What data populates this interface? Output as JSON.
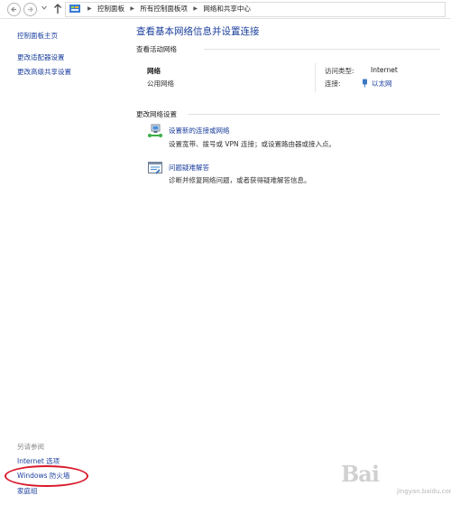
{
  "address_bar": {
    "breadcrumbs": [
      "控制面板",
      "所有控制面板项",
      "网络和共享中心"
    ]
  },
  "left_nav": {
    "home": "控制面板主页",
    "change_adapter": "更改适配器设置",
    "change_sharing": "更改高级共享设置",
    "see_also": "另请参阅",
    "internet_options": "Internet 选项",
    "firewall": "Windows 防火墙",
    "homegroup": "家庭组"
  },
  "main": {
    "title": "查看基本网络信息并设置连接",
    "active_networks_header": "查看活动网络",
    "network_name": "网络",
    "network_type": "公用网络",
    "access_type_label": "访问类型:",
    "access_type_value": "Internet",
    "connections_label": "连接:",
    "connection_value": "以太网",
    "change_settings_header": "更改网络设置",
    "tasks": [
      {
        "link": "设置新的连接或网络",
        "desc": "设置宽带、拨号或 VPN 连接；或设置路由器或接入点。"
      },
      {
        "link": "问题疑难解答",
        "desc": "诊断并修复网络问题，或者获得疑难解答信息。"
      }
    ]
  },
  "watermark": {
    "text": "Bai",
    "sub": "jingyan.baidu.com"
  },
  "colors": {
    "link": "#1a3e9c",
    "highlight": "#d9192b"
  }
}
